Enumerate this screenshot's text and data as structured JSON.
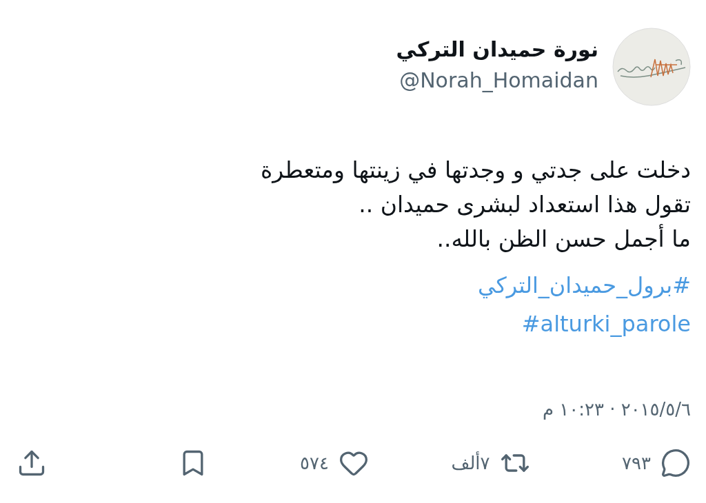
{
  "author": {
    "name": "نورة حميدان التركي",
    "handle": "@Norah_Homaidan"
  },
  "body": {
    "lines": [
      "دخلت على جدتي و وجدتها في زينتها ومتعطرة",
      "تقول هذا استعداد لبشرى حميدان ..",
      "ما أجمل حسن الظن بالله.."
    ],
    "hashtags": [
      "#برول_حميدان_التركي",
      "#alturki_parole"
    ]
  },
  "timestamp": "٢٠١٥/٥/٦ · ١٠:٢٣ م",
  "actions": [
    {
      "kind": "reply",
      "count": "٧٩٣"
    },
    {
      "kind": "retweet",
      "count": "٧ألف"
    },
    {
      "kind": "like",
      "count": "٥٧٤"
    },
    {
      "kind": "bookmark"
    },
    {
      "kind": "share"
    }
  ]
}
